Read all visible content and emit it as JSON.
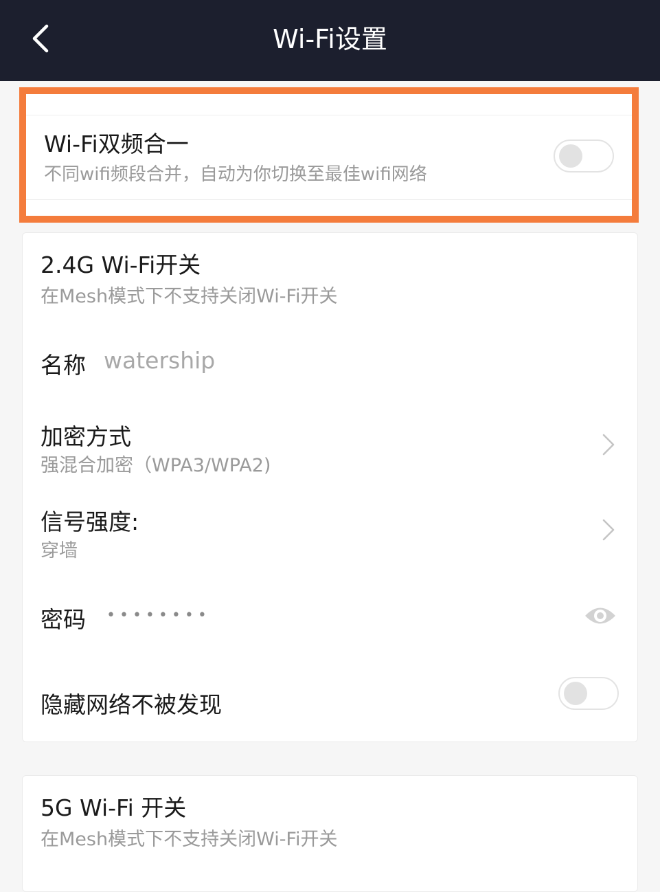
{
  "header": {
    "title": "Wi-Fi设置",
    "back_icon": "chevron-left-icon"
  },
  "dual_band": {
    "title": "Wi-Fi双频合一",
    "subtitle": "不同wifi频段合并，自动为你切换至最佳wifi网络",
    "enabled": false,
    "highlight_color": "#f47c3c"
  },
  "wifi_24g": {
    "title": "2.4G Wi-Fi开关",
    "subtitle": "在Mesh模式下不支持关闭Wi-Fi开关",
    "name_label": "名称",
    "name_value": "watership",
    "encryption_label": "加密方式",
    "encryption_value": "强混合加密（WPA3/WPA2)",
    "signal_label": "信号强度:",
    "signal_value": "穿墙",
    "password_label": "密码",
    "password_mask": "••••••••",
    "hidden_label": "隐藏网络不被发现",
    "hidden_enabled": false
  },
  "wifi_5g": {
    "title": "5G Wi-Fi 开关",
    "subtitle": "在Mesh模式下不支持关闭Wi-Fi开关"
  }
}
